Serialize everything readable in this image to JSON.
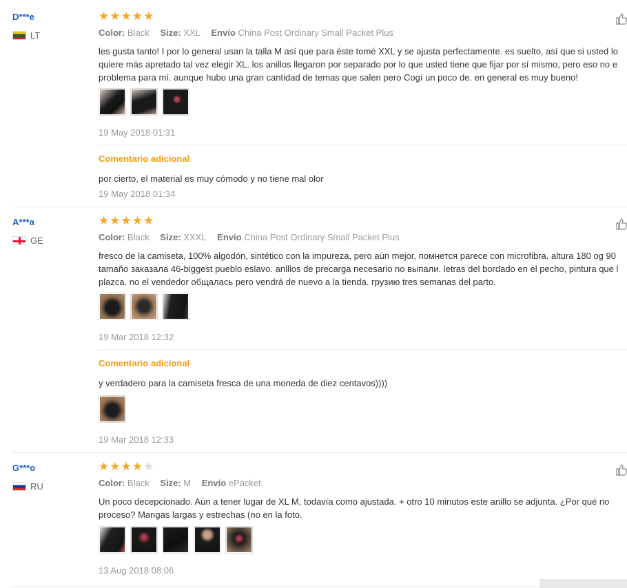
{
  "labels": {
    "color": "Color:",
    "size": "Size:",
    "shipping": "Envío"
  },
  "extra_title": "Comentario adicional",
  "reviews": [
    {
      "user": "D***e",
      "country": "LT",
      "rating": 5,
      "color": "Black",
      "size": "XXL",
      "shipping": "China Post Ordinary Small Packet Plus",
      "lines": [
        "les gusta tanto! I por lo general usan la talla M así que para éste tomé XXL y se ajusta perfectamente. es suelto, así que si usted lo",
        "quiere más apretado tal vez elegir XL. los anillos llegaron por separado por lo que usted tiene que fijar por sí mismo, pero eso no e",
        "problema para mí. aunque hubo una gran cantidad de temas que salen pero Cogí un poco de. en general es muy bueno!"
      ],
      "date": "19 May 2018 01:31",
      "extra_text": "por cierto, el material es muy cómodo y no tiene mal olor",
      "extra_date": "19 May 2018 01:34"
    },
    {
      "user": "A***a",
      "country": "GE",
      "rating": 5,
      "color": "Black",
      "size": "XXXL",
      "shipping": "China Post Ordinary Small Packet Plus",
      "lines": [
        "fresco de la camiseta, 100% algodón, sintético con la impureza, pero aún mejor, помнется parece con microfibra. altura 180 og 90",
        "tamaño заказала 46-biggest pueblo eslavo. anillos de precarga necesario no выпали. letras del bordado en el pecho, pintura que l",
        "plazca. no el vendedor общалась pero vendrá de nuevo a la tienda. грузию tres semanas del parto."
      ],
      "date": "19 Mar 2018 12:32",
      "extra_text": "y verdadero para la camiseta fresca de una moneda de diez centavos))))",
      "extra_date": "19 Mar 2018 12:33"
    },
    {
      "user": "G***o",
      "country": "RU",
      "rating": 4,
      "color": "Black",
      "size": "M",
      "shipping": "ePacket",
      "lines": [
        "Un poco decepcionado. Aún a tener lugar de XL M, todavía como ajustada. + otro 10 minutos este anillo se adjunta. ¿Por qué no",
        "proceso? Mangas largas y estrechas (no en la foto."
      ],
      "date": "13 Aug 2018 08:06"
    }
  ]
}
